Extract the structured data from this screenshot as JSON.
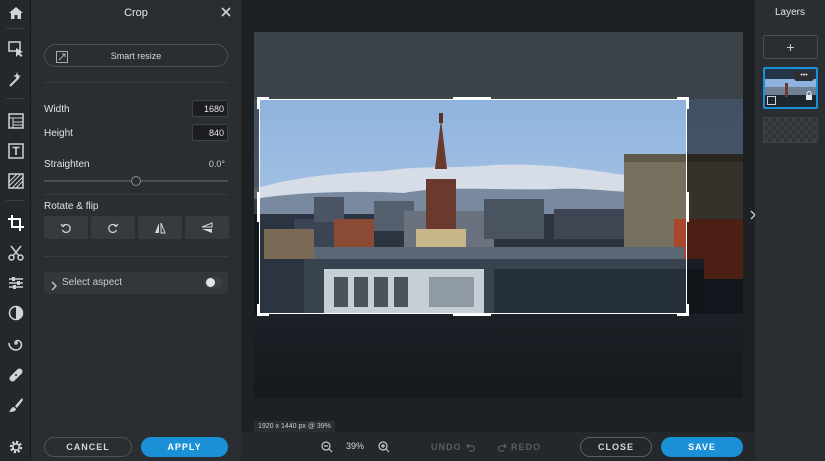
{
  "crop_panel": {
    "title": "Crop",
    "smart_resize_label": "Smart resize",
    "width_label": "Width",
    "width_value": "1680",
    "height_label": "Height",
    "height_value": "840",
    "straighten_label": "Straighten",
    "straighten_value": "0.0°",
    "straighten_level": 0.5,
    "rotate_flip_label": "Rotate & flip",
    "select_aspect_label": "Select aspect",
    "select_aspect_enabled": false,
    "cancel_label": "CANCEL",
    "apply_label": "APPLY"
  },
  "canvas": {
    "image_info": "1920 x 1440 px @ 39%"
  },
  "bottom_bar": {
    "zoom_value": "39%",
    "undo_label": "UNDO",
    "redo_label": "REDO",
    "close_label": "CLOSE",
    "save_label": "SAVE"
  },
  "layers_panel": {
    "title": "Layers",
    "add_label": "+",
    "more_label": "•••"
  },
  "colors": {
    "accent": "#1a90d6",
    "panel_bg": "#2a2d31",
    "workspace_bg": "#1e2124"
  },
  "tools": [
    "home-icon",
    "select-icon",
    "magic-icon",
    "layout-icon",
    "text-icon",
    "texture-icon",
    "crop-icon",
    "cut-icon",
    "adjust-icon",
    "filter-icon",
    "liquify-icon",
    "heal-icon",
    "brush-icon",
    "settings-icon"
  ]
}
